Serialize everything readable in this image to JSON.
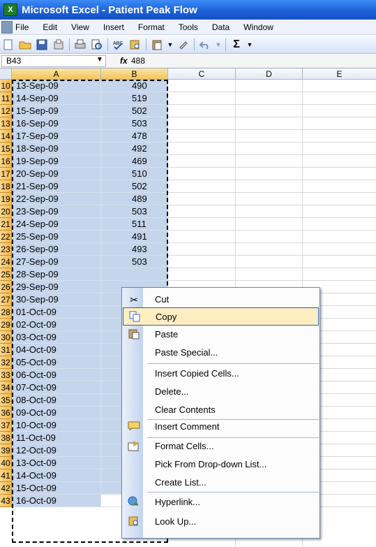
{
  "window": {
    "title": "Microsoft Excel - Patient Peak Flow"
  },
  "menu": [
    "File",
    "Edit",
    "View",
    "Insert",
    "Format",
    "Tools",
    "Data",
    "Window"
  ],
  "formula_bar": {
    "name_box": "B43",
    "fx_symbol": "fx",
    "value": "488"
  },
  "columns": [
    "A",
    "B",
    "C",
    "D",
    "E"
  ],
  "rows": [
    {
      "num": "10",
      "date": "13-Sep-09",
      "value": "490"
    },
    {
      "num": "11",
      "date": "14-Sep-09",
      "value": "519"
    },
    {
      "num": "12",
      "date": "15-Sep-09",
      "value": "502"
    },
    {
      "num": "13",
      "date": "16-Sep-09",
      "value": "503"
    },
    {
      "num": "14",
      "date": "17-Sep-09",
      "value": "478"
    },
    {
      "num": "15",
      "date": "18-Sep-09",
      "value": "492"
    },
    {
      "num": "16",
      "date": "19-Sep-09",
      "value": "469"
    },
    {
      "num": "17",
      "date": "20-Sep-09",
      "value": "510"
    },
    {
      "num": "18",
      "date": "21-Sep-09",
      "value": "502"
    },
    {
      "num": "19",
      "date": "22-Sep-09",
      "value": "489"
    },
    {
      "num": "20",
      "date": "23-Sep-09",
      "value": "503"
    },
    {
      "num": "21",
      "date": "24-Sep-09",
      "value": "511"
    },
    {
      "num": "22",
      "date": "25-Sep-09",
      "value": "491"
    },
    {
      "num": "23",
      "date": "26-Sep-09",
      "value": "493"
    },
    {
      "num": "24",
      "date": "27-Sep-09",
      "value": "503"
    },
    {
      "num": "25",
      "date": "28-Sep-09",
      "value": ""
    },
    {
      "num": "26",
      "date": "29-Sep-09",
      "value": ""
    },
    {
      "num": "27",
      "date": "30-Sep-09",
      "value": ""
    },
    {
      "num": "28",
      "date": "01-Oct-09",
      "value": ""
    },
    {
      "num": "29",
      "date": "02-Oct-09",
      "value": ""
    },
    {
      "num": "30",
      "date": "03-Oct-09",
      "value": ""
    },
    {
      "num": "31",
      "date": "04-Oct-09",
      "value": ""
    },
    {
      "num": "32",
      "date": "05-Oct-09",
      "value": ""
    },
    {
      "num": "33",
      "date": "06-Oct-09",
      "value": ""
    },
    {
      "num": "34",
      "date": "07-Oct-09",
      "value": ""
    },
    {
      "num": "35",
      "date": "08-Oct-09",
      "value": ""
    },
    {
      "num": "36",
      "date": "09-Oct-09",
      "value": ""
    },
    {
      "num": "37",
      "date": "10-Oct-09",
      "value": ""
    },
    {
      "num": "38",
      "date": "11-Oct-09",
      "value": ""
    },
    {
      "num": "39",
      "date": "12-Oct-09",
      "value": ""
    },
    {
      "num": "40",
      "date": "13-Oct-09",
      "value": ""
    },
    {
      "num": "41",
      "date": "14-Oct-09",
      "value": ""
    },
    {
      "num": "42",
      "date": "15-Oct-09",
      "value": ""
    },
    {
      "num": "43",
      "date": "16-Oct-09",
      "value": "488"
    }
  ],
  "context_menu": [
    {
      "label": "Cut",
      "icon": "scissors-icon"
    },
    {
      "label": "Copy",
      "icon": "copy-icon",
      "highlighted": true
    },
    {
      "label": "Paste",
      "icon": "paste-icon"
    },
    {
      "label": "Paste Special...",
      "icon": ""
    },
    {
      "label": "Insert Copied Cells...",
      "icon": ""
    },
    {
      "label": "Delete...",
      "icon": ""
    },
    {
      "label": "Clear Contents",
      "icon": ""
    },
    {
      "label": "Insert Comment",
      "icon": "comment-icon"
    },
    {
      "label": "Format Cells...",
      "icon": "format-cells-icon"
    },
    {
      "label": "Pick From Drop-down List...",
      "icon": ""
    },
    {
      "label": "Create List...",
      "icon": ""
    },
    {
      "label": "Hyperlink...",
      "icon": "hyperlink-icon"
    },
    {
      "label": "Look Up...",
      "icon": "lookup-icon"
    }
  ],
  "colors": {
    "selection": "#c5d5eb",
    "row_header": "#f3b84c",
    "highlight": "#ffeec2",
    "title_bar": "#1a5ed6"
  }
}
